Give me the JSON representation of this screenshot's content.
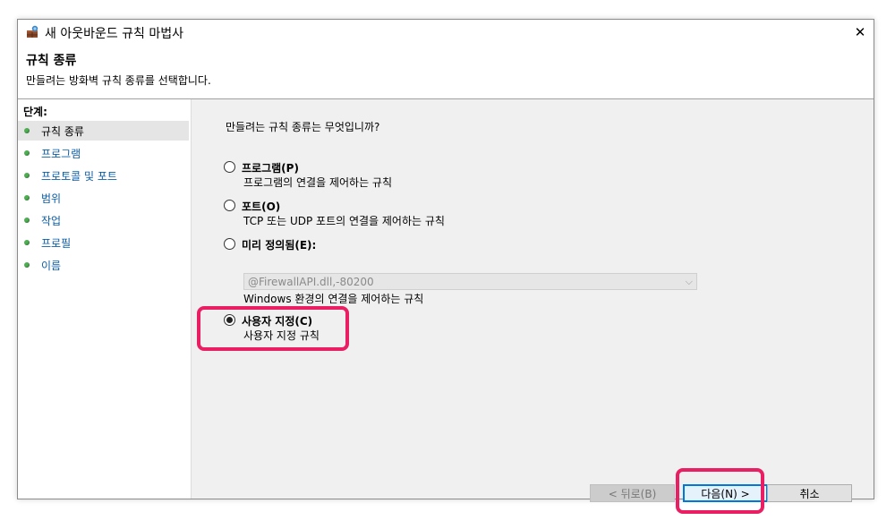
{
  "window": {
    "title": "새 아웃바운드 규칙 마법사",
    "close_glyph": "✕"
  },
  "header": {
    "title": "규칙 종류",
    "subtitle": "만들려는 방화벽 규칙 종류를 선택합니다."
  },
  "sidebar": {
    "steps_label": "단계:",
    "items": [
      {
        "label": "규칙 종류"
      },
      {
        "label": "프로그램"
      },
      {
        "label": "프로토콜 및 포트"
      },
      {
        "label": "범위"
      },
      {
        "label": "작업"
      },
      {
        "label": "프로필"
      },
      {
        "label": "이름"
      }
    ],
    "active_index": 0,
    "step_dot_color": "#4caf50"
  },
  "content": {
    "question": "만들려는 규칙 종류는 무엇입니까?",
    "options": [
      {
        "label": "프로그램(P)",
        "description": "프로그램의 연결을 제어하는 규칙",
        "checked": false
      },
      {
        "label": "포트(O)",
        "description": "TCP 또는 UDP 포트의 연결을 제어하는 규칙",
        "checked": false
      },
      {
        "label": "미리 정의됨(E):",
        "description": "Windows 환경의 연결을 제어하는 규칙",
        "checked": false
      },
      {
        "label": "사용자 지정(C)",
        "description": "사용자 지정 규칙",
        "checked": true
      }
    ],
    "predefined_select": {
      "value": "@FirewallAPI.dll,-80200",
      "disabled": true
    }
  },
  "buttons": {
    "back": "< 뒤로(B)",
    "next": "다음(N) >",
    "cancel": "취소"
  },
  "colors": {
    "highlight": "#e91e63",
    "link": "#0b5ea8",
    "focus": "#0078d7"
  }
}
